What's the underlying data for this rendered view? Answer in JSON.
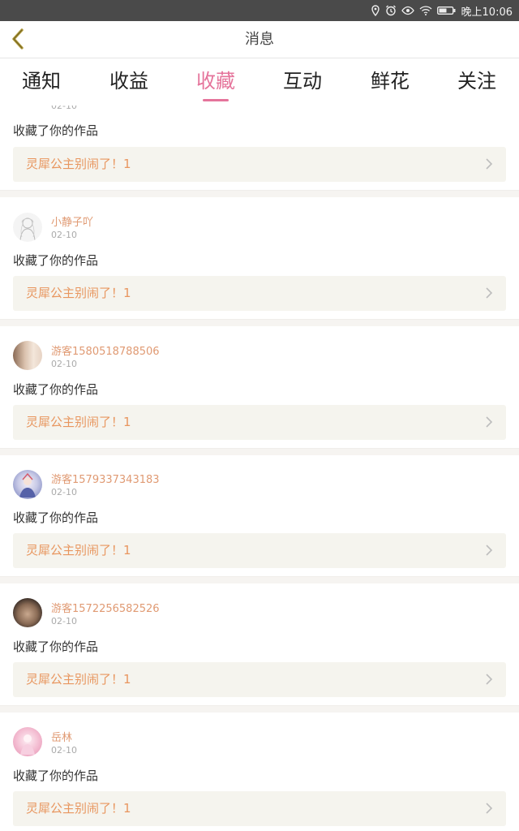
{
  "status_bar": {
    "time": "晚上10:06",
    "icons": [
      "location-icon",
      "alarm-icon",
      "eye-icon",
      "wifi-icon",
      "battery-icon"
    ]
  },
  "header": {
    "title": "消息",
    "back_icon": "chevron-left-icon"
  },
  "tabs": [
    {
      "label": "通知",
      "active": false
    },
    {
      "label": "收益",
      "active": false
    },
    {
      "label": "收藏",
      "active": true
    },
    {
      "label": "互动",
      "active": false
    },
    {
      "label": "鲜花",
      "active": false
    },
    {
      "label": "关注",
      "active": false
    }
  ],
  "colors": {
    "accent_pink": "#e5749b",
    "username_orange": "#e09a73",
    "work_title_orange": "#e8965f",
    "status_bar_bg": "#4a4a4a",
    "work_box_bg": "#f5f4ee"
  },
  "feed": {
    "partial_top": {
      "date": "02-10",
      "action": "收藏了你的作品",
      "work_title": "灵犀公主别闹了！1"
    },
    "items": [
      {
        "username": "小静子吖",
        "date": "02-10",
        "action": "收藏了你的作品",
        "work_title": "灵犀公主别闹了！1",
        "avatar_icon": "sketch-girl-avatar"
      },
      {
        "username": "游客1580518788506",
        "date": "02-10",
        "action": "收藏了你的作品",
        "work_title": "灵犀公主别闹了！1",
        "avatar_icon": "photo-girl-avatar"
      },
      {
        "username": "游客1579337343183",
        "date": "02-10",
        "action": "收藏了你的作品",
        "work_title": "灵犀公主别闹了！1",
        "avatar_icon": "anime-character-avatar"
      },
      {
        "username": "游客1572256582526",
        "date": "02-10",
        "action": "收藏了你的作品",
        "work_title": "灵犀公主别闹了！1",
        "avatar_icon": "photo-person-avatar"
      },
      {
        "username": "岳林",
        "date": "02-10",
        "action": "收藏了你的作品",
        "work_title": "灵犀公主别闹了！1",
        "avatar_icon": "pink-anime-avatar"
      }
    ]
  }
}
